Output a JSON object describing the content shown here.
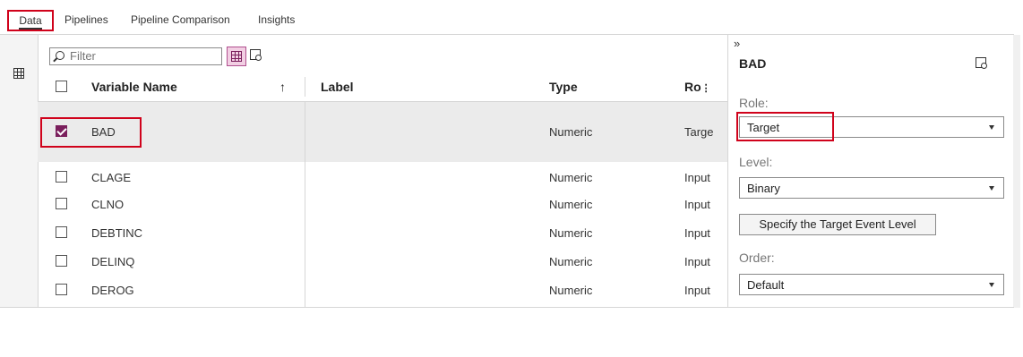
{
  "tabs": [
    "Data",
    "Pipelines",
    "Pipeline Comparison",
    "Insights"
  ],
  "filter": {
    "placeholder": "Filter"
  },
  "table": {
    "headers": {
      "name": "Variable Name",
      "sort": "↑",
      "label": "Label",
      "type": "Type",
      "role": "Ro"
    },
    "rows": [
      {
        "name": "BAD",
        "label": "",
        "type": "Numeric",
        "role": "Targe",
        "checked": true
      },
      {
        "name": "CLAGE",
        "label": "",
        "type": "Numeric",
        "role": "Input",
        "checked": false
      },
      {
        "name": "CLNO",
        "label": "",
        "type": "Numeric",
        "role": "Input",
        "checked": false
      },
      {
        "name": "DEBTINC",
        "label": "",
        "type": "Numeric",
        "role": "Input",
        "checked": false
      },
      {
        "name": "DELINQ",
        "label": "",
        "type": "Numeric",
        "role": "Input",
        "checked": false
      },
      {
        "name": "DEROG",
        "label": "",
        "type": "Numeric",
        "role": "Input",
        "checked": false
      }
    ]
  },
  "panel": {
    "collapse": "»",
    "title": "BAD",
    "role_label": "Role:",
    "role_value": "Target",
    "level_label": "Level:",
    "level_value": "Binary",
    "event_button": "Specify the Target Event Level",
    "order_label": "Order:",
    "order_value": "Default"
  },
  "colors": {
    "accent": "#7a1f5c",
    "highlight": "#d0021b"
  }
}
